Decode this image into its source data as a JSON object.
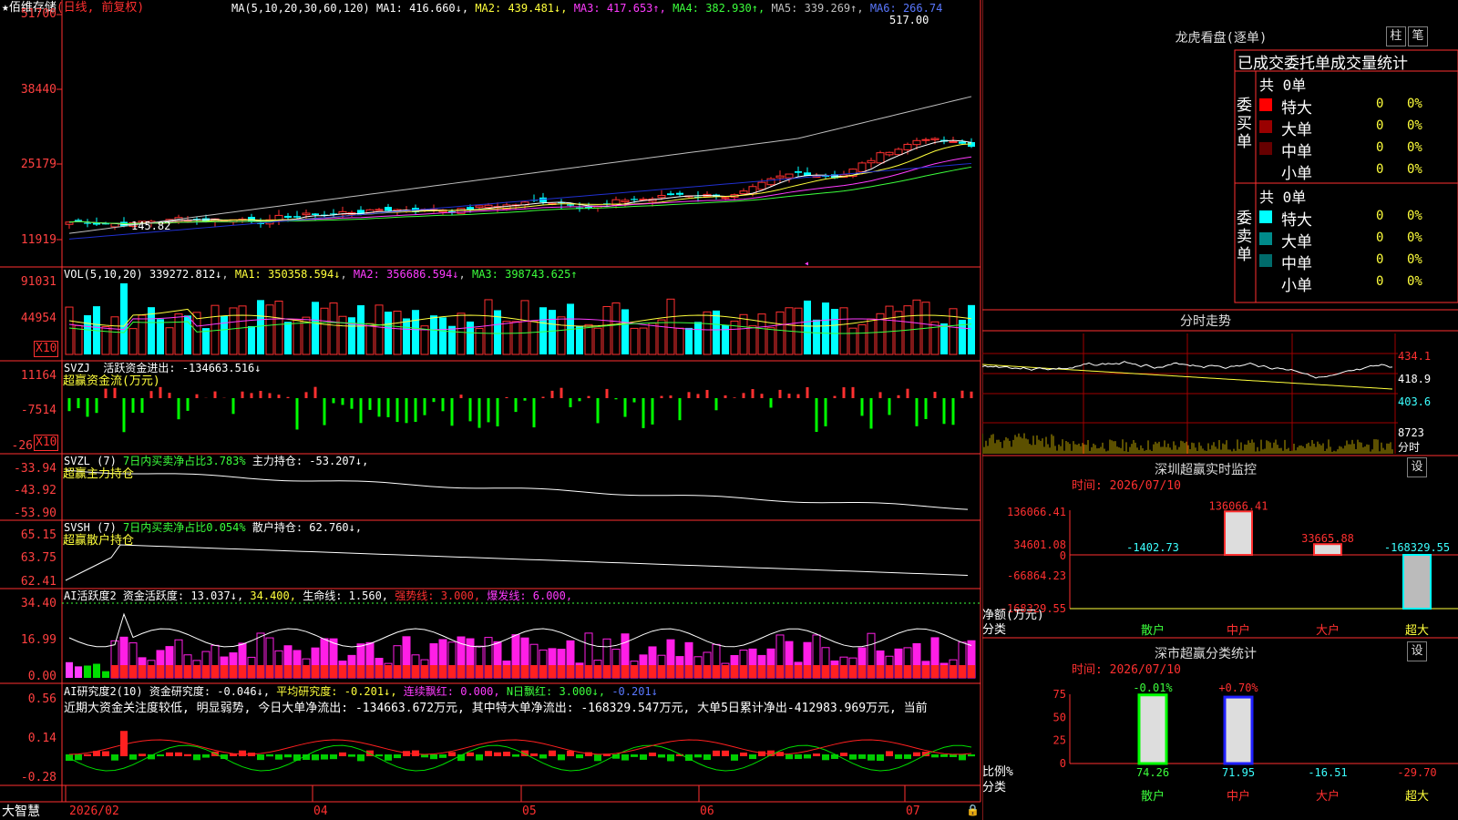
{
  "main": {
    "stock_name": "佰维存储",
    "mode": "(日线, 前复权)",
    "ma_header": "MA(5,10,20,30,60,120)",
    "ma_values": [
      {
        "text": "MA1: 416.660↓",
        "color": "#ffffff"
      },
      {
        "text": "MA2: 439.481↓",
        "color": "#ffff3c"
      },
      {
        "text": "MA3: 417.653↑",
        "color": "#ff3cff"
      },
      {
        "text": "MA4: 382.930↑",
        "color": "#3cff3c"
      },
      {
        "text": "MA5: 339.269↑",
        "color": "#c0c0c0"
      },
      {
        "text": "MA6: 266.74",
        "color": "#5a78ff"
      }
    ],
    "price_high_label": "517.00",
    "price_low_label": "145.82",
    "y_ticks": [
      "51700",
      "38440",
      "25179",
      "11919"
    ]
  },
  "vol": {
    "header": "VOL(5,10,20)",
    "value": "339272.812↓",
    "ma1": "MA1: 350358.594↓",
    "ma2": "MA2: 356686.594↓",
    "ma3": "MA3: 398743.625↑",
    "y_ticks": [
      "91031",
      "44954"
    ],
    "unit": "X10"
  },
  "svzj": {
    "header": "SVZJ",
    "label": "活跃资金进出: -134663.516↓",
    "subtitle": "超赢资金流(万元)",
    "y_ticks": [
      "11164",
      "-7514",
      "-26"
    ],
    "unit": "X10"
  },
  "svzl": {
    "header": "SVZL (7)",
    "ratio": "7日内买卖净占比3.783%",
    "holding": "主力持仓: -53.207↓,",
    "subtitle": "超赢主力持仓",
    "y_ticks": [
      "-33.94",
      "-43.92",
      "-53.90"
    ]
  },
  "svsh": {
    "header": "SVSH (7)",
    "ratio": "7日内买卖净占比0.054%",
    "holding": "散户持仓: 62.760↓,",
    "subtitle": "超赢散户持仓",
    "y_ticks": [
      "65.15",
      "63.75",
      "62.41"
    ]
  },
  "ai1": {
    "header": "AI活跃度2",
    "v1": "资金活跃度: 13.037↓,",
    "v2": "34.400,",
    "v3": "生命线: 1.560,",
    "v4": "强势线: 3.000,",
    "v5": "爆发线: 6.000,",
    "y_ticks": [
      "34.40",
      "16.99",
      "0.00"
    ]
  },
  "ai2": {
    "header": "AI研究度2(10)",
    "v1": "资金研究度: -0.046↓,",
    "v2": "平均研究度: -0.201↓,",
    "v3": "连续飘红: 0.000,",
    "v4": "N日飘红: 3.000↓,",
    "v5": "-0.201↓",
    "commentary": "近期大资金关注度较低, 明显弱势, 今日大单净流出: -134663.672万元, 其中特大单净流出: -168329.547万元, 大单5日累计净出-412983.969万元, 当前",
    "y_ticks": [
      "0.56",
      "0.14",
      "-0.28"
    ]
  },
  "xaxis": {
    "brand": "大智慧",
    "labels": [
      "2026/02",
      "04",
      "05",
      "06",
      "07"
    ]
  },
  "dragon": {
    "title": "龙虎看盘(逐单)",
    "btn1": "柱",
    "btn2": "笔",
    "col_title": "已成交委托单成交量统计",
    "buy_label": "委买单",
    "sell_label": "委卖单",
    "buy_total": "共 0单",
    "sell_total": "共 0单",
    "buy_rows": [
      {
        "name": "特大",
        "vol": "0",
        "pct": "0%",
        "color": "#ff0000"
      },
      {
        "name": "大单",
        "vol": "0",
        "pct": "0%",
        "color": "#990000"
      },
      {
        "name": "中单",
        "vol": "0",
        "pct": "0%",
        "color": "#660000"
      },
      {
        "name": "小单",
        "vol": "0",
        "pct": "0%",
        "color": "#000000"
      }
    ],
    "sell_rows": [
      {
        "name": "特大",
        "vol": "0",
        "pct": "0%",
        "color": "#00ffff"
      },
      {
        "name": "大单",
        "vol": "0",
        "pct": "0%",
        "color": "#008b8b"
      },
      {
        "name": "中单",
        "vol": "0",
        "pct": "0%",
        "color": "#006b6b"
      },
      {
        "name": "小单",
        "vol": "0",
        "pct": "0%",
        "color": "#000000"
      }
    ]
  },
  "intraday": {
    "title": "分时走势",
    "y_ticks": [
      "434.1",
      "418.9",
      "403.6",
      "8723"
    ],
    "unit": "分时"
  },
  "sz_monitor": {
    "title": "深圳超赢实时监控",
    "btn": "设",
    "time": "时间: 2026/07/10",
    "y_ticks": [
      "136066.41",
      "34601.08",
      "0",
      "-66864.23",
      "-168329.55"
    ],
    "bars": [
      {
        "cat": "散户",
        "value": -1402.73,
        "label": "-1402.73"
      },
      {
        "cat": "中户",
        "value": 136066.41,
        "label": "136066.41"
      },
      {
        "cat": "大户",
        "value": 33665.88,
        "label": "33665.88"
      },
      {
        "cat": "超大",
        "value": -168329.55,
        "label": "-168329.55"
      }
    ],
    "ylabel": "净额(万元)",
    "xlabel": "分类"
  },
  "sz_class": {
    "title": "深市超赢分类统计",
    "btn": "设",
    "time": "时间: 2026/07/10",
    "y_ticks": [
      "75",
      "50",
      "25",
      "0"
    ],
    "bars": [
      {
        "cat": "散户",
        "value": 74.26,
        "label": "74.26",
        "change": "-0.01%"
      },
      {
        "cat": "中户",
        "value": 71.95,
        "label": "71.95",
        "change": "+0.70%"
      },
      {
        "cat": "大户",
        "value": -16.51,
        "label": "-16.51",
        "change": ""
      },
      {
        "cat": "超大",
        "value": -29.7,
        "label": "-29.70",
        "change": ""
      }
    ],
    "ylabel": "比例%",
    "xlabel": "分类"
  }
}
